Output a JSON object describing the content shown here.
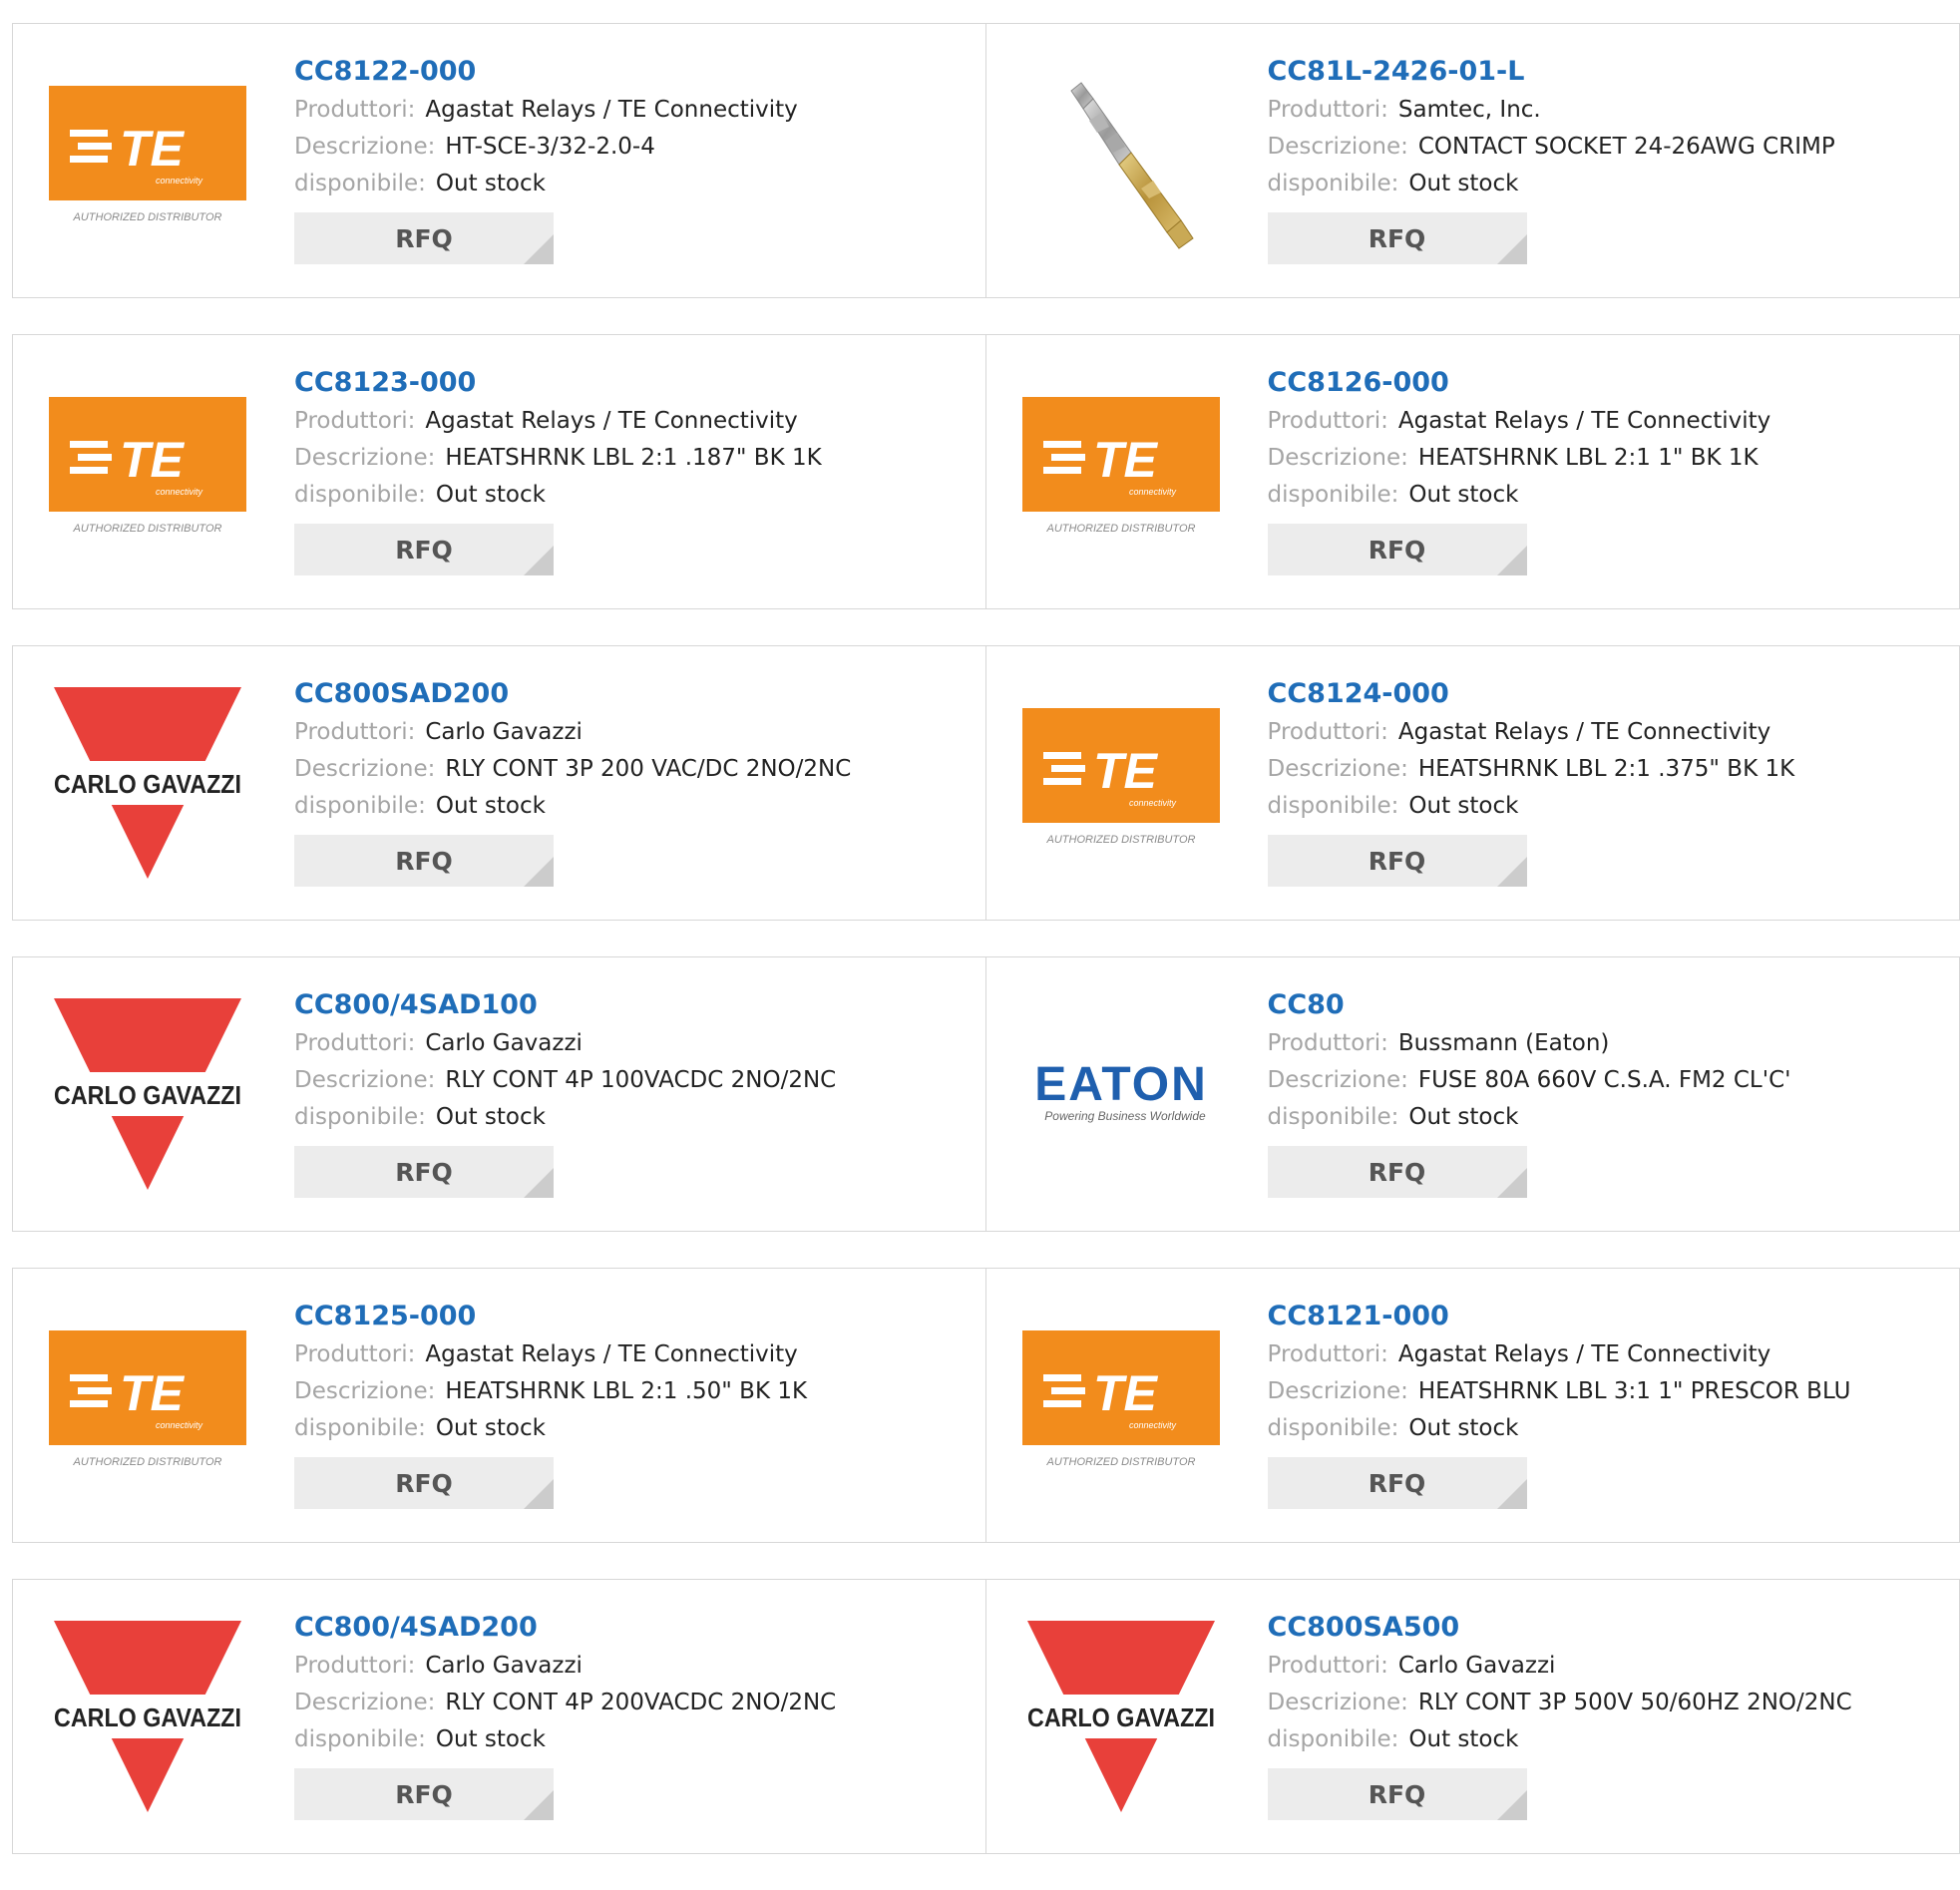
{
  "labels": {
    "manufacturer": "Produttori:",
    "description": "Descrizione:",
    "availability": "disponibile:",
    "rfq": "RFQ"
  },
  "logos": {
    "te": {
      "brand_text": "TE",
      "sub_text": "connectivity",
      "caption": "AUTHORIZED DISTRIBUTOR",
      "color": "#f28c1c"
    },
    "carlo": {
      "brand_text": "CARLO GAVAZZI",
      "color": "#e8403a"
    },
    "eaton": {
      "brand_text": "EATON",
      "tagline": "Powering Business Worldwide",
      "color": "#1f5fae"
    }
  },
  "link_color": "#1f6db8",
  "products": [
    {
      "part": "CC8122-000",
      "manufacturer": "Agastat Relays / TE Connectivity",
      "description": "HT-SCE-3/32-2.0-4",
      "availability": "Out stock",
      "image": "te-logo"
    },
    {
      "part": "CC81L-2426-01-L",
      "manufacturer": "Samtec, Inc.",
      "description": "CONTACT SOCKET 24-26AWG CRIMP",
      "availability": "Out stock",
      "image": "crimp-contact-photo"
    },
    {
      "part": "CC8123-000",
      "manufacturer": "Agastat Relays / TE Connectivity",
      "description": "HEATSHRNK LBL 2:1 .187\" BK 1K",
      "availability": "Out stock",
      "image": "te-logo"
    },
    {
      "part": "CC8126-000",
      "manufacturer": "Agastat Relays / TE Connectivity",
      "description": "HEATSHRNK LBL 2:1 1\" BK 1K",
      "availability": "Out stock",
      "image": "te-logo"
    },
    {
      "part": "CC800SAD200",
      "manufacturer": "Carlo Gavazzi",
      "description": "RLY CONT 3P 200 VAC/DC 2NO/2NC",
      "availability": "Out stock",
      "image": "carlo-gavazzi-logo"
    },
    {
      "part": "CC8124-000",
      "manufacturer": "Agastat Relays / TE Connectivity",
      "description": "HEATSHRNK LBL 2:1 .375\" BK 1K",
      "availability": "Out stock",
      "image": "te-logo"
    },
    {
      "part": "CC800/4SAD100",
      "manufacturer": "Carlo Gavazzi",
      "description": "RLY CONT 4P 100VACDC 2NO/2NC",
      "availability": "Out stock",
      "image": "carlo-gavazzi-logo"
    },
    {
      "part": "CC80",
      "manufacturer": "Bussmann (Eaton)",
      "description": "FUSE 80A 660V C.S.A. FM2 CL'C'",
      "availability": "Out stock",
      "image": "eaton-logo"
    },
    {
      "part": "CC8125-000",
      "manufacturer": "Agastat Relays / TE Connectivity",
      "description": "HEATSHRNK LBL 2:1 .50\" BK 1K",
      "availability": "Out stock",
      "image": "te-logo"
    },
    {
      "part": "CC8121-000",
      "manufacturer": "Agastat Relays / TE Connectivity",
      "description": "HEATSHRNK LBL 3:1 1\" PRESCOR BLU",
      "availability": "Out stock",
      "image": "te-logo"
    },
    {
      "part": "CC800/4SAD200",
      "manufacturer": "Carlo Gavazzi",
      "description": "RLY CONT 4P 200VACDC 2NO/2NC",
      "availability": "Out stock",
      "image": "carlo-gavazzi-logo"
    },
    {
      "part": "CC800SA500",
      "manufacturer": "Carlo Gavazzi",
      "description": "RLY CONT 3P 500V 50/60HZ 2NO/2NC",
      "availability": "Out stock",
      "image": "carlo-gavazzi-logo"
    }
  ]
}
